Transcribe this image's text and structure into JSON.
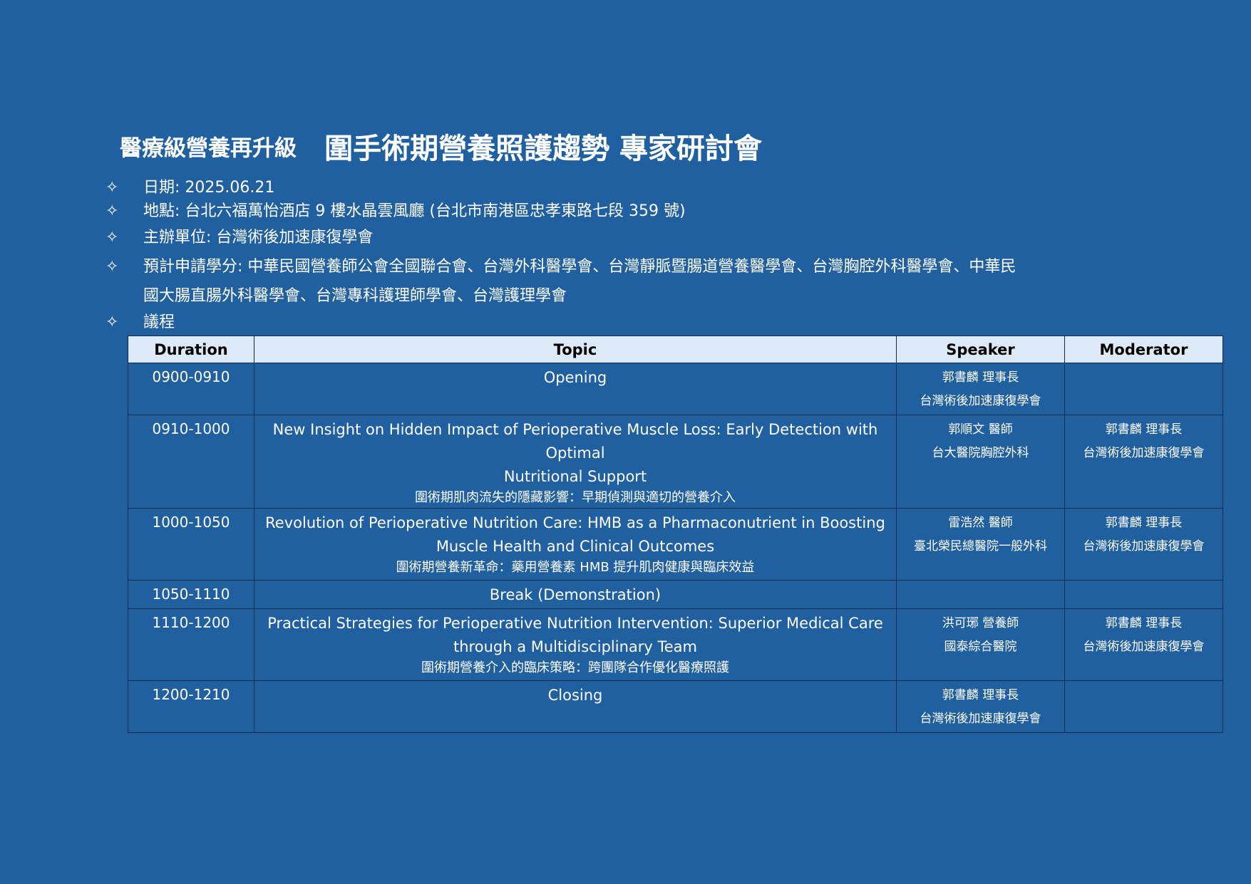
{
  "header": {
    "prefix": "醫療級營養再升級",
    "title": "圍手術期營養照護趨勢  專家研討會"
  },
  "info": {
    "bullet_glyph": "✧",
    "date": "日期: 2025.06.21",
    "venue": "地點:  台北六福萬怡酒店 9 樓水晶雲風廳  (台北市南港區忠孝東路七段 359 號)",
    "organizer": "主辦單位:  台灣術後加速康復學會",
    "credits_line1": "預計申請學分:  中華民國營養師公會全國聯合會、台灣外科醫學會、台灣靜脈暨腸道營養醫學會、台灣胸腔外科醫學會、中華民",
    "credits_line2": "國大腸直腸外科醫學會、台灣專科護理師學會、台灣護理學會",
    "agenda_label": "議程"
  },
  "table": {
    "headers": [
      "Duration",
      "Topic",
      "Speaker",
      "Moderator"
    ],
    "rows": [
      {
        "duration": "0900-0910",
        "topic_en_1": "Opening",
        "topic_en_2": "",
        "topic_zh": "",
        "speaker_name": "郭書麟  理事長",
        "speaker_org": "台灣術後加速康復學會",
        "moderator_name": "",
        "moderator_org": ""
      },
      {
        "duration": "0910-1000",
        "topic_en_1": "New Insight on Hidden Impact of Perioperative Muscle Loss: Early Detection with Optimal",
        "topic_en_2": "Nutritional Support",
        "topic_zh": "圍術期肌肉流失的隱藏影響：早期偵測與適切的營養介入",
        "speaker_name": "郭順文  醫師",
        "speaker_org": "台大醫院胸腔外科",
        "moderator_name": "郭書麟  理事長",
        "moderator_org": "台灣術後加速康復學會"
      },
      {
        "duration": "1000-1050",
        "topic_en_1": "Revolution of Perioperative Nutrition Care: HMB as a Pharmaconutrient in Boosting",
        "topic_en_2": "Muscle Health and Clinical Outcomes",
        "topic_zh": "圍術期營養新革命：藥用營養素 HMB 提升肌肉健康與臨床效益",
        "speaker_name": "雷浩然  醫師",
        "speaker_org": "臺北榮民總醫院一般外科",
        "moderator_name": "郭書麟  理事長",
        "moderator_org": "台灣術後加速康復學會"
      },
      {
        "duration": "1050-1110",
        "topic_en_1": "Break (Demonstration)",
        "topic_en_2": "",
        "topic_zh": "",
        "speaker_name": "",
        "speaker_org": "",
        "moderator_name": "",
        "moderator_org": ""
      },
      {
        "duration": "1110-1200",
        "topic_en_1": "Practical Strategies for Perioperative Nutrition Intervention: Superior Medical Care",
        "topic_en_2": "through a Multidisciplinary Team",
        "topic_zh": "圍術期營養介入的臨床策略：跨團隊合作優化醫療照護",
        "speaker_name": "洪可琊  營養師",
        "speaker_org": "國泰綜合醫院",
        "moderator_name": "郭書麟  理事長",
        "moderator_org": "台灣術後加速康復學會"
      },
      {
        "duration": "1200-1210",
        "topic_en_1": "Closing",
        "topic_en_2": "",
        "topic_zh": "",
        "speaker_name": "郭書麟  理事長",
        "speaker_org": "台灣術後加速康復學會",
        "moderator_name": "",
        "moderator_org": ""
      }
    ]
  },
  "colors": {
    "background": "#2060a0",
    "header_row": "#dce9f7",
    "border": "#0d2b4d"
  }
}
